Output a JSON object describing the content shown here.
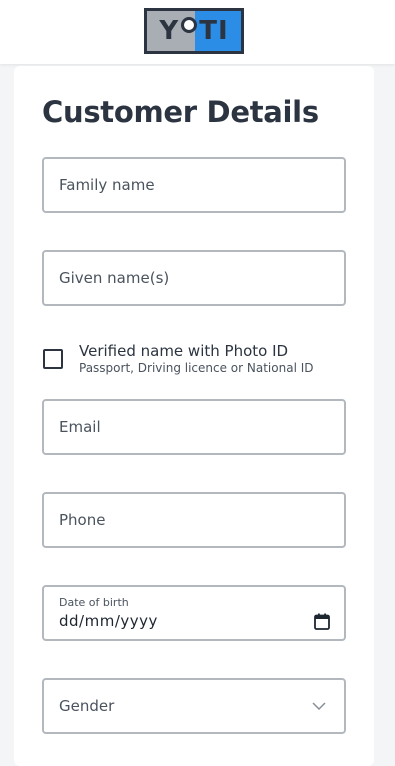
{
  "header": {
    "logo_text": "YOTI",
    "brand_colors": {
      "grey": "#a9aeb4",
      "blue": "#2b8de6",
      "dark": "#2b3440"
    }
  },
  "form": {
    "title": "Customer Details",
    "family_name_placeholder": "Family name",
    "given_name_placeholder": "Given name(s)",
    "verified_label": "Verified name with Photo ID",
    "verified_sub": "Passport, Driving licence or National ID",
    "verified_checked": false,
    "email_placeholder": "Email",
    "phone_placeholder": "Phone",
    "dob_label": "Date of birth",
    "dob_value": "dd/mm/yyyy",
    "gender_placeholder": "Gender"
  },
  "icons": {
    "calendar": "calendar-icon",
    "chevron": "chevron-down-icon"
  }
}
